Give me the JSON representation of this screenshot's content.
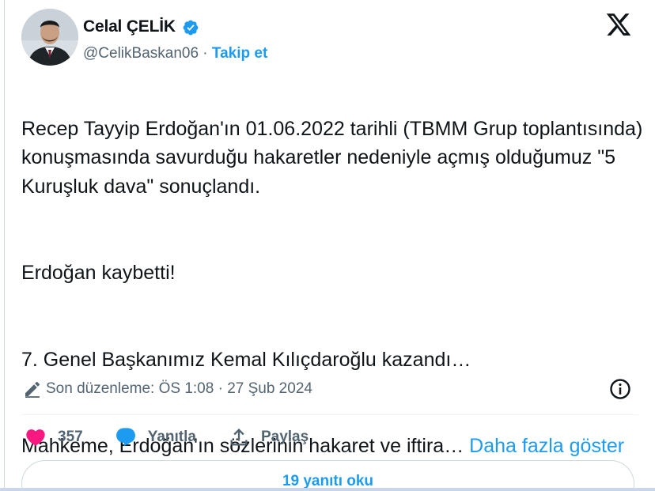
{
  "author": {
    "name": "Celal ÇELİK",
    "handle": "@CelikBaskan06",
    "separator": " · ",
    "follow_label": "Takip et"
  },
  "tweet": {
    "paragraphs": [
      "Recep Tayyip Erdoğan'ın 01.06.2022 tarihli (TBMM Grup toplantısında) konuşmasında savurduğu hakaretler nedeniyle açmış olduğumuz \"5 Kuruşluk dava\" sonuçlandı.",
      "Erdoğan kaybetti!",
      "7. Genel Başkanımız Kemal Kılıçdaroğlu kazandı…",
      "Mahkeme, Erdoğan'ın sözlerinin hakaret ve iftira…"
    ],
    "show_more_label": "Daha fazla göster"
  },
  "edited": {
    "text": "Son düzenleme: ÖS 1:08 · 27 Şub 2024"
  },
  "actions": {
    "likes": "357",
    "reply_label": "Yanıtla",
    "share_label": "Paylaş"
  },
  "replies_button_label": "19 yanıtı oku",
  "colors": {
    "accent": "#1d9bf0",
    "like": "#f91880",
    "text": "#0f1419",
    "muted": "#536471"
  },
  "icons": [
    "verified-badge-icon",
    "x-logo-icon",
    "pencil-icon",
    "info-icon",
    "heart-icon",
    "reply-bubble-icon",
    "share-icon"
  ]
}
